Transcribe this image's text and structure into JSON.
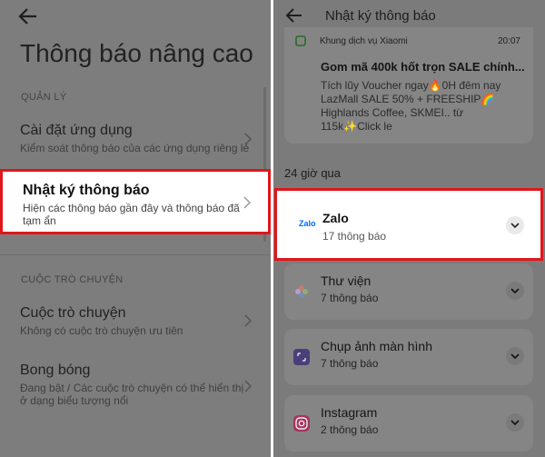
{
  "left": {
    "page_title": "Thông báo nâng cao",
    "sections": {
      "manage": "QUẢN LÝ",
      "conversations": "CUỘC TRÒ CHUYỆN"
    },
    "items": [
      {
        "title": "Cài đặt ứng dụng",
        "subtitle": "Kiểm soát thông báo của các ứng dụng riêng lẻ"
      },
      {
        "title": "Nhật ký thông báo",
        "subtitle": "Hiện các thông báo gần đây và thông báo đã tạm ẩn"
      },
      {
        "title": "Cuộc trò chuyện",
        "subtitle": "Không có cuộc trò chuyện ưu tiên"
      },
      {
        "title": "Bong bóng",
        "subtitle": "Đang bật / Các cuộc trò chuyện có thể hiển thị ở dạng biểu tượng nổi"
      }
    ]
  },
  "right": {
    "header_title": "Nhật ký thông báo",
    "notification": {
      "app_name": "Khung dịch vụ Xiaomi",
      "time": "20:07",
      "title": "Gom mã 400k hốt trọn SALE chính...",
      "body": "Tích lũy Voucher ngay🔥0H đêm nay LazMall SALE 50% + FREESHIP🌈 Highlands Coffee, SKMEI.. từ 115k✨Click le"
    },
    "section_label": "24 giờ qua",
    "apps": [
      {
        "name": "Zalo",
        "count": "17 thông báo",
        "icon": "zalo-icon"
      },
      {
        "name": "Thư viện",
        "count": "7 thông báo",
        "icon": "gallery-icon"
      },
      {
        "name": "Chụp ảnh màn hình",
        "count": "7 thông báo",
        "icon": "screenshot-icon"
      },
      {
        "name": "Instagram",
        "count": "2 thông báo",
        "icon": "instagram-icon"
      }
    ]
  },
  "colors": {
    "highlight_border": "#e0161b",
    "overlay_bg": "#7d7d7d",
    "zalo_blue": "#0068ff"
  }
}
